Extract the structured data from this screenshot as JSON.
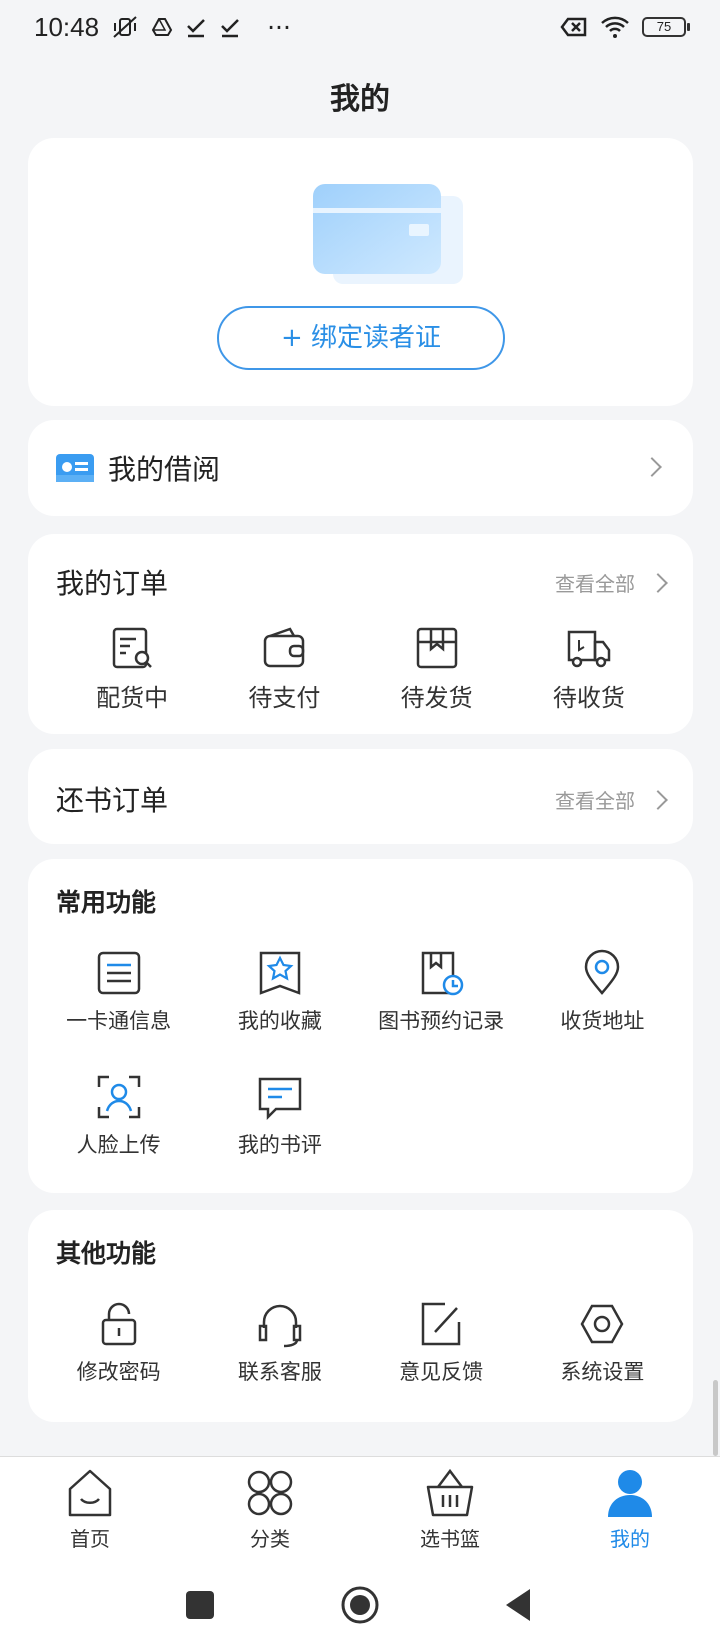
{
  "status_bar": {
    "time": "10:48",
    "extra": "···",
    "battery": "75"
  },
  "page": {
    "title": "我的"
  },
  "hero": {
    "bind_button": "+ 绑定读者证"
  },
  "borrow": {
    "label": "我的借阅"
  },
  "orders": {
    "title": "我的订单",
    "view_all": "查看全部",
    "items": [
      {
        "label": "配货中",
        "icon": "order-search-icon"
      },
      {
        "label": "待支付",
        "icon": "wallet-icon"
      },
      {
        "label": "待发货",
        "icon": "package-icon"
      },
      {
        "label": "待收货",
        "icon": "truck-icon"
      }
    ]
  },
  "return_orders": {
    "title": "还书订单",
    "view_all": "查看全部"
  },
  "common": {
    "title": "常用功能",
    "items": [
      {
        "label": "一卡通信息",
        "icon": "card-info-icon"
      },
      {
        "label": "我的收藏",
        "icon": "bookmark-star-icon"
      },
      {
        "label": "图书预约记录",
        "icon": "book-clock-icon"
      },
      {
        "label": "收货地址",
        "icon": "location-pin-icon"
      },
      {
        "label": "人脸上传",
        "icon": "face-scan-icon"
      },
      {
        "label": "我的书评",
        "icon": "comment-icon"
      }
    ]
  },
  "other": {
    "title": "其他功能",
    "items": [
      {
        "label": "修改密码",
        "icon": "lock-icon"
      },
      {
        "label": "联系客服",
        "icon": "headset-icon"
      },
      {
        "label": "意见反馈",
        "icon": "edit-icon"
      },
      {
        "label": "系统设置",
        "icon": "settings-hex-icon"
      }
    ]
  },
  "tabbar": {
    "items": [
      {
        "label": "首页",
        "icon": "home-icon"
      },
      {
        "label": "分类",
        "icon": "category-icon"
      },
      {
        "label": "选书篮",
        "icon": "basket-icon"
      },
      {
        "label": "我的",
        "icon": "user-icon",
        "active": true
      }
    ]
  },
  "colors": {
    "accent": "#1f8ae8",
    "background": "#f4f5f7",
    "card": "#ffffff"
  }
}
